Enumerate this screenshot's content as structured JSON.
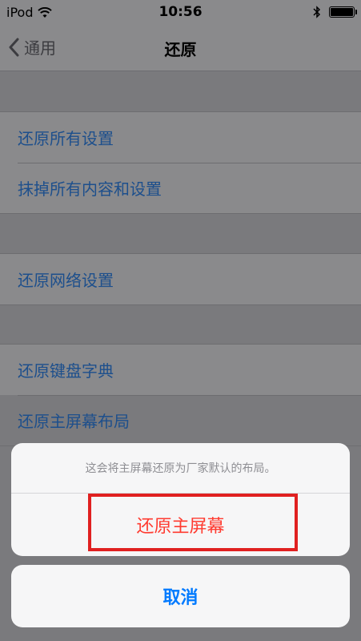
{
  "status_bar": {
    "carrier": "iPod",
    "time": "10:56",
    "icons": [
      "wifi-icon",
      "bluetooth-icon",
      "battery-icon"
    ]
  },
  "nav": {
    "back_label": "通用",
    "title": "还原"
  },
  "groups": [
    {
      "items": [
        {
          "label": "还原所有设置"
        },
        {
          "label": "抹掉所有内容和设置"
        }
      ]
    },
    {
      "items": [
        {
          "label": "还原网络设置"
        }
      ]
    },
    {
      "items": [
        {
          "label": "还原键盘字典"
        },
        {
          "label": "还原主屏幕布局"
        }
      ]
    }
  ],
  "sheet": {
    "message": "这会将主屏幕还原为厂家默认的布局。",
    "action_label": "还原主屏幕",
    "cancel_label": "取消"
  },
  "colors": {
    "link_blue": "#1d4f8c",
    "destructive_red": "#ff3b30",
    "cancel_blue": "#007aff",
    "highlight_outline": "#e02020"
  }
}
